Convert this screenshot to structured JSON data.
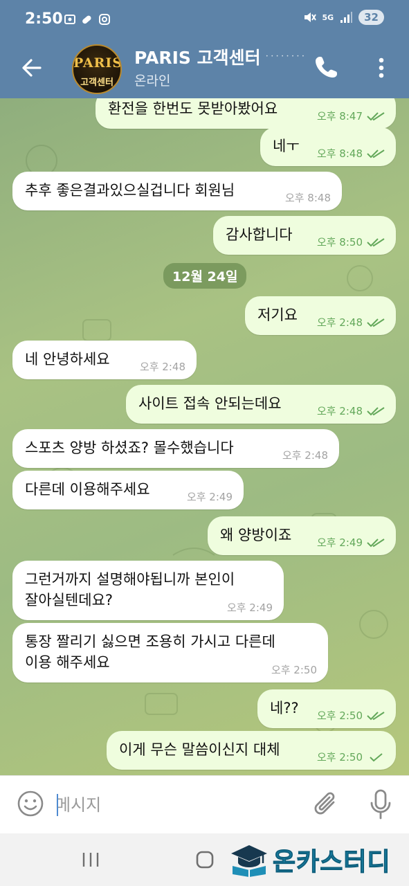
{
  "status_bar": {
    "time": "2:50",
    "battery": "32",
    "network": "5G"
  },
  "header": {
    "title": "PARIS 고객센터",
    "subtitle": "온라인",
    "avatar_line1": "PARIS",
    "avatar_line2": "고객센터"
  },
  "messages": [
    {
      "dir": "out",
      "text": "환전을 한번도 못받아봤어요",
      "time": "오후 8:47",
      "ticks": "double"
    },
    {
      "dir": "out",
      "text": "네ㅜ",
      "time": "오후 8:48",
      "ticks": "double"
    },
    {
      "dir": "in",
      "text": "추후 좋은결과있으실겁니다 회원님",
      "time": "오후 8:48"
    },
    {
      "dir": "out",
      "text": "감사합니다",
      "time": "오후 8:50",
      "ticks": "double"
    },
    {
      "dir": "out",
      "text": "저기요",
      "time": "오후 2:48",
      "ticks": "double"
    },
    {
      "dir": "in",
      "text": "네 안녕하세요",
      "time": "오후 2:48"
    },
    {
      "dir": "out",
      "text": "사이트 접속 안되는데요",
      "time": "오후 2:48",
      "ticks": "double"
    },
    {
      "dir": "in",
      "text": "스포츠 양방 하셨죠? 몰수했습니다",
      "time": "오후 2:48"
    },
    {
      "dir": "in",
      "text": "다른데 이용해주세요",
      "time": "오후 2:49"
    },
    {
      "dir": "out",
      "text": "왜 양방이죠",
      "time": "오후 2:49",
      "ticks": "double"
    },
    {
      "dir": "in",
      "line1": "그런거까지 설명해야됩니까 본인이",
      "line2": "잘아실텐데요?",
      "time": "오후 2:49"
    },
    {
      "dir": "in",
      "line1": "통장 짤리기 싫으면 조용히 가시고 다른데",
      "line2": "이용 해주세요",
      "time": "오후 2:50"
    },
    {
      "dir": "out",
      "text": "네??",
      "time": "오후 2:50",
      "ticks": "double"
    },
    {
      "dir": "out",
      "text": "이게 무슨 말씀이신지 대체",
      "time": "오후 2:50",
      "ticks": "single"
    }
  ],
  "date_separator": "12월 24일",
  "composer": {
    "placeholder": "메시지",
    "value": ""
  },
  "watermark": "온카스터디",
  "colors": {
    "header": "#5d83a8",
    "outgoing_bubble": "#effdde",
    "incoming_bubble": "#ffffff",
    "ticks": "#63a85a"
  },
  "icons": [
    "back-arrow-icon",
    "phone-icon",
    "more-vert-icon",
    "emoji-icon",
    "attach-icon",
    "mic-icon"
  ]
}
